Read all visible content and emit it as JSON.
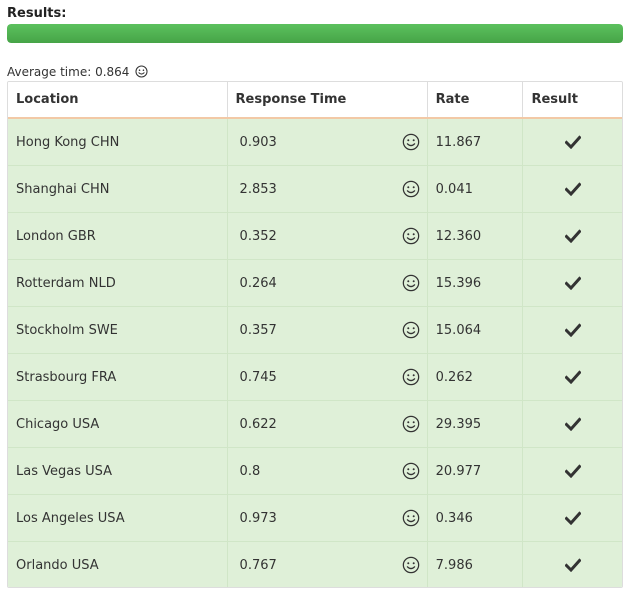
{
  "header": {
    "results_label": "Results:",
    "progress_percent": 100,
    "progress_color": "#4cae4c"
  },
  "summary": {
    "avg_label": "Average time:",
    "avg_value": "0.864",
    "avg_icon": "smiley-icon"
  },
  "table": {
    "columns": [
      "Location",
      "Response Time",
      "Rate",
      "Result"
    ],
    "row_color": "#dff0d8",
    "rows": [
      {
        "location": "Hong Kong CHN",
        "response_time": "0.903",
        "rate": "11.867",
        "result_icon": "check-icon"
      },
      {
        "location": "Shanghai CHN",
        "response_time": "2.853",
        "rate": "0.041",
        "result_icon": "check-icon"
      },
      {
        "location": "London GBR",
        "response_time": "0.352",
        "rate": "12.360",
        "result_icon": "check-icon"
      },
      {
        "location": "Rotterdam NLD",
        "response_time": "0.264",
        "rate": "15.396",
        "result_icon": "check-icon"
      },
      {
        "location": "Stockholm SWE",
        "response_time": "0.357",
        "rate": "15.064",
        "result_icon": "check-icon"
      },
      {
        "location": "Strasbourg FRA",
        "response_time": "0.745",
        "rate": "0.262",
        "result_icon": "check-icon"
      },
      {
        "location": "Chicago USA",
        "response_time": "0.622",
        "rate": "29.395",
        "result_icon": "check-icon"
      },
      {
        "location": "Las Vegas USA",
        "response_time": "0.8",
        "rate": "20.977",
        "result_icon": "check-icon"
      },
      {
        "location": "Los Angeles USA",
        "response_time": "0.973",
        "rate": "0.346",
        "result_icon": "check-icon"
      },
      {
        "location": "Orlando USA",
        "response_time": "0.767",
        "rate": "7.986",
        "result_icon": "check-icon"
      }
    ]
  }
}
